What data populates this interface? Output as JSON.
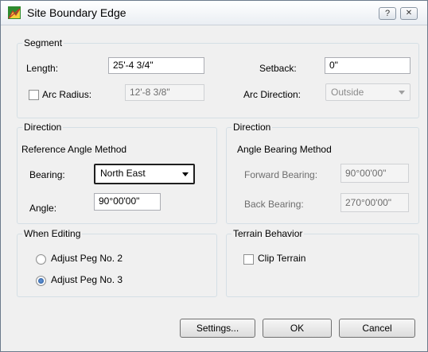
{
  "window": {
    "title": "Site Boundary Edge",
    "help_label": "?",
    "close_label": "✕"
  },
  "segment": {
    "legend": "Segment",
    "length_label": "Length:",
    "length_value": "25'-4 3/4\"",
    "setback_label": "Setback:",
    "setback_value": "0\"",
    "arc_radius_label": "Arc Radius:",
    "arc_radius_value": "12'-8 3/8\"",
    "arc_radius_checked": false,
    "arc_direction_label": "Arc Direction:",
    "arc_direction_value": "Outside"
  },
  "direction_left": {
    "legend": "Direction",
    "method": "Reference Angle Method",
    "bearing_label": "Bearing:",
    "bearing_value": "North East",
    "angle_label": "Angle:",
    "angle_value": "90°00'00\""
  },
  "direction_right": {
    "legend": "Direction",
    "method": "Angle Bearing Method",
    "forward_label": "Forward Bearing:",
    "forward_value": "90°00'00\"",
    "back_label": "Back Bearing:",
    "back_value": "270°00'00\""
  },
  "editing": {
    "legend": "When Editing",
    "opt1": "Adjust Peg No. 2",
    "opt2": "Adjust Peg No. 3",
    "selected": 2
  },
  "terrain": {
    "legend": "Terrain Behavior",
    "clip_label": "Clip Terrain",
    "clip_checked": false
  },
  "buttons": {
    "settings": "Settings...",
    "ok": "OK",
    "cancel": "Cancel"
  }
}
